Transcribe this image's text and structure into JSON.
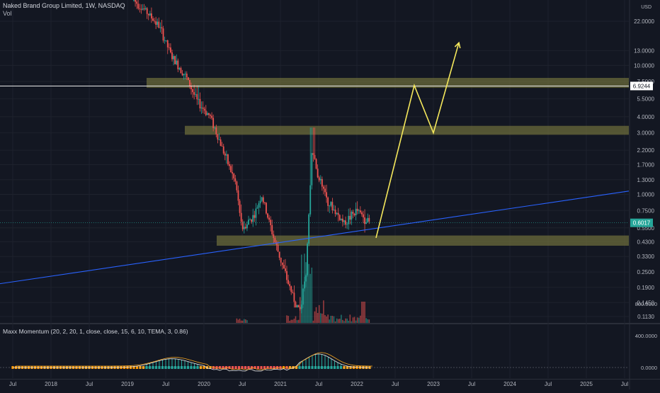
{
  "header": {
    "symbol_line": "Naked Brand Group Limited, 1W, NASDAQ",
    "volume_label": "Vol"
  },
  "indicator": {
    "title": "Maxx Momentum (20, 2, 20, 1, close, close, 15, 6, 10, TEMA, 3, 0.86)",
    "axis_labels": [
      "800.0000",
      "400.0000",
      "0.0000"
    ]
  },
  "currency": "USD",
  "chart_data": {
    "type": "candlestick",
    "title": "Naked Brand Group Limited, 1W, NASDAQ",
    "y_scale": "log",
    "y_tick_labels": [
      "32.0000",
      "22.0000",
      "13.0000",
      "10.0000",
      "7.5000",
      "5.5000",
      "4.0000",
      "3.0000",
      "2.2000",
      "1.7000",
      "1.3000",
      "1.0000",
      "0.7500",
      "0.5500",
      "0.4300",
      "0.3300",
      "0.2500",
      "0.1900",
      "0.1450",
      "0.1130"
    ],
    "x_tick_labels": [
      "Jul",
      "2018",
      "Jul",
      "2019",
      "Jul",
      "2020",
      "Jul",
      "2021",
      "Jul",
      "2022",
      "Jul",
      "2023",
      "Jul",
      "2024",
      "Jul",
      "2025",
      "Jul"
    ],
    "price_labels": {
      "level": "6.9244",
      "current": "0.6017"
    },
    "price_path": [
      [
        "2018-10",
        32.0
      ],
      [
        "2018-12",
        26.0
      ],
      [
        "2019-02",
        20.0
      ],
      [
        "2019-04",
        11.5
      ],
      [
        "2019-06",
        8.5
      ],
      [
        "2019-08",
        5.2
      ],
      [
        "2019-10",
        4.0
      ],
      [
        "2019-12",
        2.2
      ],
      [
        "2020-02",
        1.2
      ],
      [
        "2020-03",
        0.55
      ],
      [
        "2020-05",
        0.7
      ],
      [
        "2020-06",
        1.0
      ],
      [
        "2020-08",
        0.45
      ],
      [
        "2020-10",
        0.22
      ],
      [
        "2020-12",
        0.12
      ],
      [
        "2021-01",
        0.25
      ],
      [
        "2021-02",
        2.4
      ],
      [
        "2021-03",
        1.3
      ],
      [
        "2021-05",
        0.8
      ],
      [
        "2021-07",
        0.6
      ],
      [
        "2021-09",
        0.75
      ],
      [
        "2021-11",
        0.6017
      ]
    ],
    "zones": [
      {
        "from": "2018-12",
        "to": "2025-12",
        "low": 6.7,
        "high": 8.0,
        "color": "#6e6e3c"
      },
      {
        "from": "2019-06",
        "to": "2025-12",
        "low": 2.9,
        "high": 3.4,
        "color": "#6e6e3c"
      },
      {
        "from": "2019-11",
        "to": "2025-12",
        "low": 0.4,
        "high": 0.48,
        "color": "#6e6e3c"
      }
    ],
    "horizontal_line": 6.9244,
    "trendline": {
      "from": [
        "2017-03",
        0.21
      ],
      "to": [
        "2025-12",
        1.22
      ],
      "color": "#2962ff"
    },
    "projection": {
      "points": [
        [
          "2021-12",
          0.46
        ],
        [
          "2022-06",
          7.0
        ],
        [
          "2022-09",
          3.0
        ],
        [
          "2023-01",
          15.0
        ]
      ],
      "color": "#f5e85c"
    },
    "colors": {
      "up": "#26a69a",
      "down": "#ef5350",
      "background": "#131722",
      "grid": "#1e222d"
    }
  }
}
